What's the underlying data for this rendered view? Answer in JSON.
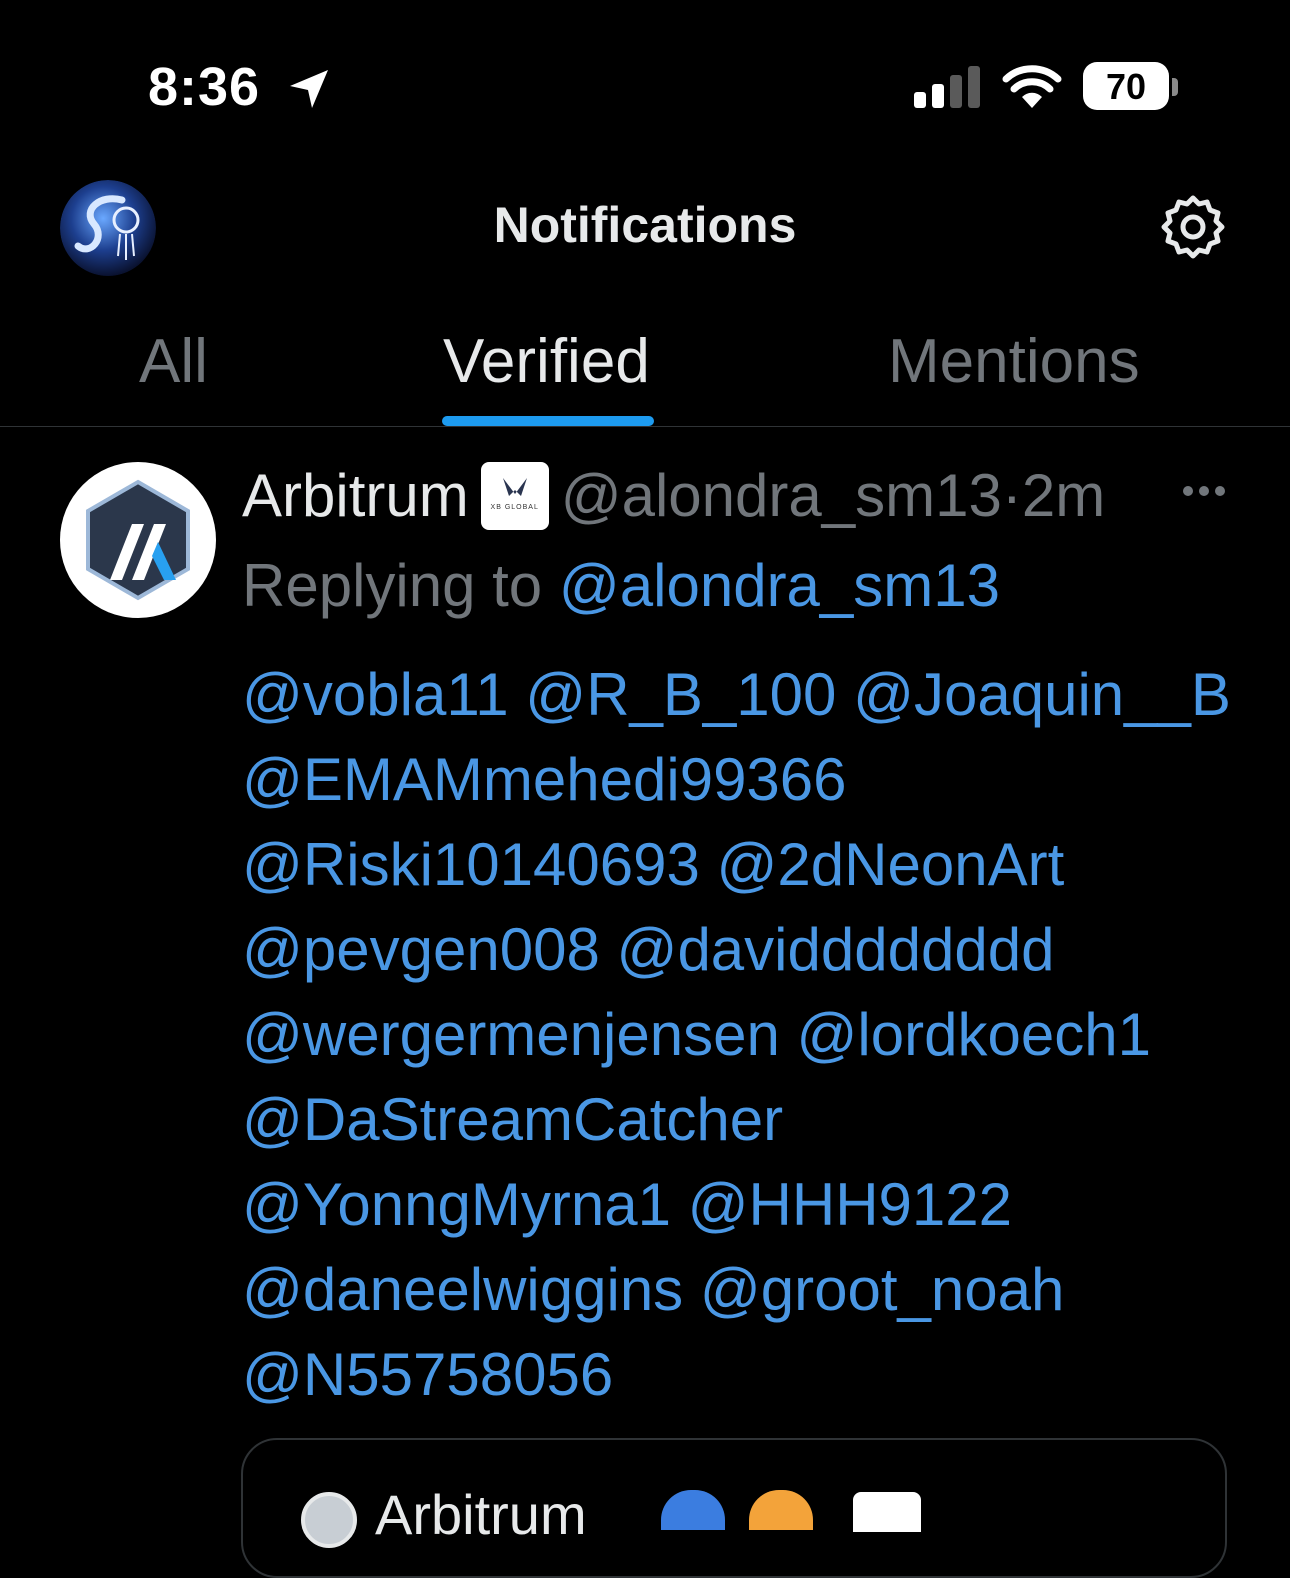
{
  "status_bar": {
    "time": "8:36",
    "battery": "70"
  },
  "header": {
    "title": "Notifications"
  },
  "tabs": [
    {
      "label": "All",
      "active": false
    },
    {
      "label": "Verified",
      "active": true
    },
    {
      "label": "Mentions",
      "active": false
    }
  ],
  "colors": {
    "accent": "#1d9bf0",
    "link": "#4a97e4",
    "muted": "#71767b",
    "text": "#e7e9ea",
    "background": "#000000"
  },
  "notification": {
    "author_name": "Arbitrum",
    "affiliate_badge_text": "XB GLOBAL",
    "handle": "@alondra_sm13",
    "separator": "·",
    "time": "2m",
    "replying_label": "Replying to",
    "replying_to": "@alondra_sm13",
    "body_lines": [
      "@vobla11 @R_B_100 @Joaquin__B",
      "@EMAMmehedi99366",
      "@Riski10140693 @2dNeonArt",
      "@pevgen008 @davidddddddd",
      "@wergermenjensen @lordkoech1",
      "@DaStreamCatcher",
      "@YonngMyrna1 @HHH9122",
      "@daneelwiggins @groot_noah",
      "@N55758056"
    ],
    "quoted": {
      "author_name": "Arbitrum"
    }
  }
}
